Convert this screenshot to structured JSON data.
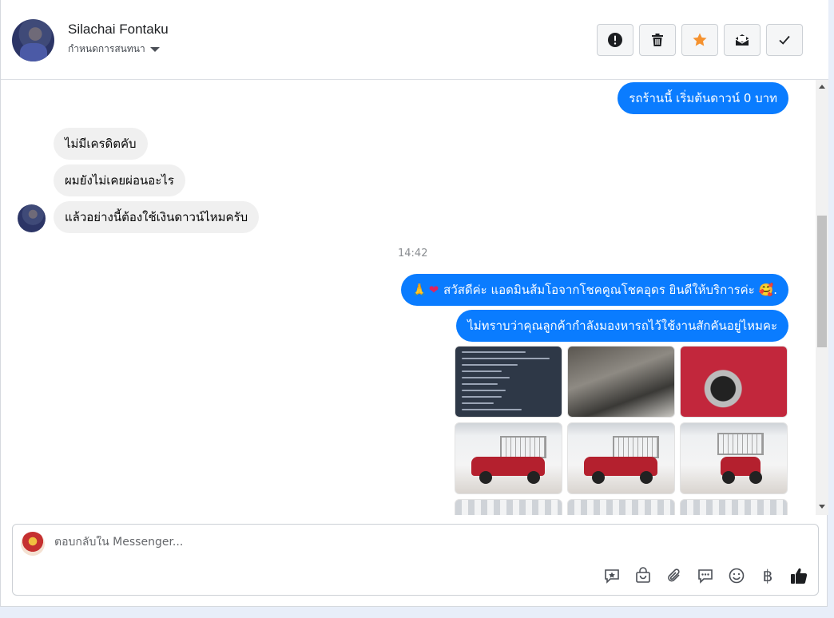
{
  "header": {
    "contact_name": "Silachai Fontaku",
    "assign_label": "กำหนดการสนทนา",
    "actions": [
      {
        "name": "mark-spam-button",
        "icon": "exclamation-icon"
      },
      {
        "name": "delete-button",
        "icon": "trash-icon"
      },
      {
        "name": "star-button",
        "icon": "star-icon"
      },
      {
        "name": "mark-unread-button",
        "icon": "envelope-icon"
      },
      {
        "name": "mark-done-button",
        "icon": "check-icon"
      }
    ]
  },
  "messages": {
    "out_0": "รถร้านนี้ เริ่มต้นดาวน์ 0 บาท",
    "in_0": "ไม่มีเครดิตคับ",
    "in_1": "ผมยังไม่เคยผ่อนอะไร",
    "in_2": "แล้วอย่างนี้ต้องใช้เงินดาวน์ไหมครับ",
    "timestamp": "14:42",
    "out_1": "สวัสดีค่ะ แอดมินส้มโอจากโชคคูณโชคอุดร ยินดีให้บริการค่ะ",
    "out_1_emoji_prefix": "🙏",
    "out_1_emoji_heart": "❤",
    "out_1_emoji_suffix": "🥰.",
    "out_2": "ไม่ทราบว่าคุณลูกค้ากำลังมองหารถไว้ใช้งานสักคันอยู่ไหมคะ"
  },
  "composer": {
    "placeholder": "ตอบกลับใน Messenger...",
    "currency_symbol": "฿"
  },
  "colors": {
    "outgoing_bubble": "#0a7cff",
    "incoming_bubble": "#f0f0f0",
    "star": "#f5922f"
  }
}
